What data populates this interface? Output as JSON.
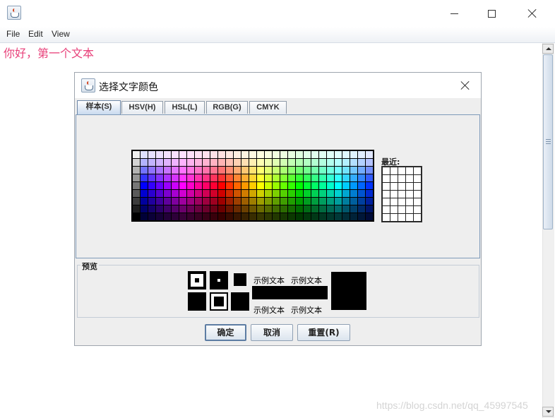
{
  "window": {
    "icon": "java-cup-icon",
    "controls": [
      "minimize-icon",
      "maximize-icon",
      "close-icon"
    ]
  },
  "menubar": {
    "file": "File",
    "edit": "Edit",
    "view": "View"
  },
  "editor": {
    "text": "你好，第一个文本",
    "text_color": "#e8417a"
  },
  "dialog": {
    "title": "选择文字颜色",
    "tabs": [
      "样本(S)",
      "HSV(H)",
      "HSL(L)",
      "RGB(G)",
      "CMYK"
    ],
    "active_tab": "样本(S)",
    "recent_label": "最近:",
    "preview_label": "预览",
    "sample_text": "示例文本",
    "buttons": {
      "ok": "确定",
      "cancel": "取消",
      "reset": "重置(R)"
    },
    "swatches": {
      "columns": 31,
      "rows": 9
    }
  },
  "watermark": "https://blog.csdn.net/qq_45997545"
}
